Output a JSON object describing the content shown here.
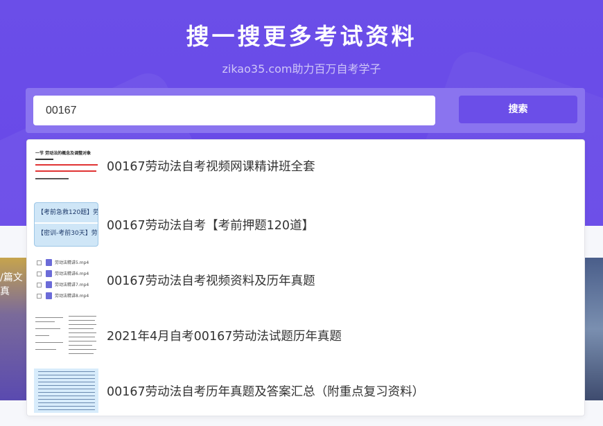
{
  "hero": {
    "title": "搜一搜更多考试资料",
    "subtitle": "zikao35.com助力百万自考学子"
  },
  "search": {
    "value": "00167",
    "button_label": "搜索"
  },
  "background": {
    "left_banner_text": "/篇文真"
  },
  "results": [
    {
      "title": "00167劳动法自考视频网课精讲班全套",
      "thumb": "document-preview"
    },
    {
      "title": "00167劳动法自考【考前押题120道】",
      "thumb": "banner-preview"
    },
    {
      "title": "00167劳动法自考视频资料及历年真题",
      "thumb": "file-list-preview"
    },
    {
      "title": "2021年4月自考00167劳动法试题历年真题",
      "thumb": "scan-preview"
    },
    {
      "title": "00167劳动法自考历年真题及答案汇总（附重点复习资料）",
      "thumb": "table-preview"
    }
  ],
  "thumb_text": {
    "doc_heading": "一节 劳动法的概念及调整对象",
    "banner_line1": "【考前急救120题】劳",
    "banner_line2": "【密训-考前30天】劳动",
    "files": [
      "劳动法精讲5.mp4",
      "劳动法精讲6.mp4",
      "劳动法精讲7.mp4",
      "劳动法精讲8.mp4"
    ]
  },
  "colors": {
    "brand": "#6b4ee8",
    "search_bar_bg": "#8a74ef"
  }
}
